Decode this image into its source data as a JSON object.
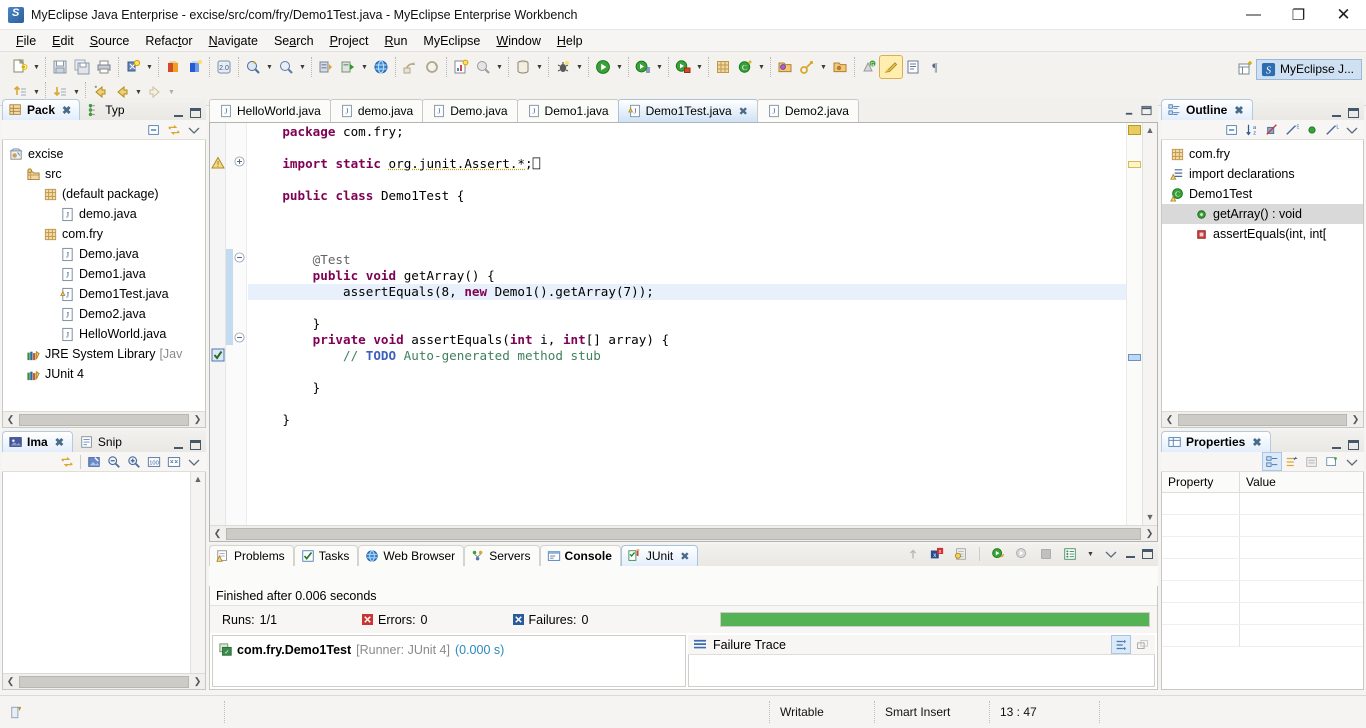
{
  "window": {
    "title": "MyEclipse Java Enterprise - excise/src/com/fry/Demo1Test.java - MyEclipse Enterprise Workbench",
    "app_icon": "myeclipse-icon",
    "minimize": "—",
    "maximize": "❐",
    "close": "✕"
  },
  "menu": [
    {
      "label": "File",
      "mnemonic": "F"
    },
    {
      "label": "Edit",
      "mnemonic": "E"
    },
    {
      "label": "Source",
      "mnemonic": "S"
    },
    {
      "label": "Refactor",
      "mnemonic": "t"
    },
    {
      "label": "Navigate",
      "mnemonic": "N"
    },
    {
      "label": "Search",
      "mnemonic": "a"
    },
    {
      "label": "Project",
      "mnemonic": "P"
    },
    {
      "label": "Run",
      "mnemonic": "R"
    },
    {
      "label": "MyEclipse",
      "mnemonic": ""
    },
    {
      "label": "Window",
      "mnemonic": "W"
    },
    {
      "label": "Help",
      "mnemonic": "H"
    }
  ],
  "toolbar": {
    "row1_groups": [
      [
        "new-wizard-icon",
        "new-dropdown-arrow"
      ],
      [
        "save-icon",
        "save-all-icon",
        "print-icon"
      ],
      [
        "myeclipse-new-icon",
        "myeclipse-dropdown-arrow"
      ],
      [
        "deploy-icon",
        "deploy2-icon"
      ],
      [
        "open-type-icon"
      ],
      [
        "search-icon",
        "search-dropdown-arrow",
        "search2-icon",
        "search2-dropdown-arrow"
      ],
      [
        "server-icon",
        "server-run-icon",
        "server-dropdown-arrow",
        "browser-icon"
      ],
      [
        "history-icon",
        "refresh-icon"
      ],
      [
        "report-icon",
        "report2-icon",
        "report2-dropdown-arrow"
      ],
      [
        "db-icon",
        "db-dropdown-arrow"
      ],
      [
        "debug-icon",
        "debug-dropdown-arrow"
      ],
      [
        "run-icon",
        "run-dropdown-arrow"
      ],
      [
        "run-config-icon",
        "run-config-dropdown-arrow"
      ],
      [
        "coverage-icon",
        "coverage-dropdown-arrow"
      ],
      [
        "new-java-project-icon",
        "new-class-icon",
        "new-class-dropdown-arrow"
      ],
      [
        "open-resource-icon",
        "key-icon",
        "key-dropdown-arrow",
        "open-folder-icon"
      ],
      [
        "annotation-icon",
        "toggle-markoccurrences-icon",
        "toggle-block-icon",
        "show-whitespace-icon"
      ]
    ],
    "row2_groups": [
      [
        "prev-annotation-icon",
        "prev-annotation-arrow"
      ],
      [
        "next-annotation-icon",
        "next-annotation-arrow"
      ],
      [
        "back-icon",
        "forward-icon",
        "forward-arrow",
        "next-edit-icon",
        "next-edit-arrow"
      ]
    ],
    "perspective_open": "open-perspective-icon",
    "perspective_active": "MyEclipse J...",
    "perspective_active_icon": "myeclipse-perspective-icon"
  },
  "package_explorer": {
    "tabs": [
      {
        "label": "Pack",
        "icon": "package-explorer-icon",
        "selected": true,
        "closeable": true
      },
      {
        "label": "Typ",
        "icon": "type-hierarchy-icon",
        "selected": false,
        "closeable": false
      }
    ],
    "toolbar": [
      "collapse-all-icon",
      "link-with-editor-icon",
      "view-menu-icon"
    ],
    "tree": [
      {
        "label": "excise",
        "icon": "java-project-icon",
        "indent": 0
      },
      {
        "label": "src",
        "icon": "source-folder-icon",
        "indent": 1
      },
      {
        "label": "(default package)",
        "icon": "package-icon",
        "indent": 2
      },
      {
        "label": "demo.java",
        "icon": "java-file-icon",
        "indent": 3
      },
      {
        "label": "com.fry",
        "icon": "package-icon",
        "indent": 2
      },
      {
        "label": "Demo.java",
        "icon": "java-file-icon",
        "indent": 3
      },
      {
        "label": "Demo1.java",
        "icon": "java-file-icon",
        "indent": 3
      },
      {
        "label": "Demo1Test.java",
        "icon": "java-file-warning-icon",
        "indent": 3
      },
      {
        "label": "Demo2.java",
        "icon": "java-file-icon",
        "indent": 3
      },
      {
        "label": "HelloWorld.java",
        "icon": "java-file-icon",
        "indent": 3
      },
      {
        "label": "JRE System Library",
        "suffix": "[Jav",
        "icon": "library-icon",
        "indent": 1
      },
      {
        "label": "JUnit 4",
        "icon": "library-icon",
        "indent": 1
      }
    ]
  },
  "image_view": {
    "tabs": [
      {
        "label": "Ima",
        "icon": "image-viewer-icon",
        "selected": true,
        "closeable": true
      },
      {
        "label": "Snip",
        "icon": "snippets-icon",
        "selected": false,
        "closeable": false
      }
    ],
    "toolbar": [
      "link-icon",
      "select-image-icon",
      "zoom-out-icon",
      "zoom-in-icon",
      "zoom-100-icon",
      "fit-icon",
      "view-menu-icon"
    ]
  },
  "editor": {
    "tabs": [
      {
        "label": "HelloWorld.java",
        "icon": "java-file-icon",
        "selected": false,
        "closeable": false
      },
      {
        "label": "demo.java",
        "icon": "java-file-icon",
        "selected": false,
        "closeable": false
      },
      {
        "label": "Demo.java",
        "icon": "java-file-icon",
        "selected": false,
        "closeable": false
      },
      {
        "label": "Demo1.java",
        "icon": "java-file-icon",
        "selected": false,
        "closeable": false
      },
      {
        "label": "Demo1Test.java",
        "icon": "java-file-warning-icon",
        "selected": true,
        "closeable": true
      },
      {
        "label": "Demo2.java",
        "icon": "java-file-icon",
        "selected": false,
        "closeable": false
      }
    ],
    "code_lines": [
      {
        "indent": 1,
        "tokens": [
          {
            "t": "package",
            "c": "kw"
          },
          {
            "t": " com.fry;",
            "c": ""
          }
        ]
      },
      {
        "indent": 0,
        "tokens": []
      },
      {
        "indent": 1,
        "fold": "plus",
        "marker": "warning",
        "tokens": [
          {
            "t": "import",
            "c": "kw"
          },
          {
            "t": " ",
            "c": ""
          },
          {
            "t": "static",
            "c": "kw"
          },
          {
            "t": " ",
            "c": ""
          },
          {
            "t": "org.junit.Assert.*",
            "c": "imp"
          },
          {
            "t": ";",
            "c": ""
          },
          {
            "t": "⎕",
            "c": ""
          }
        ]
      },
      {
        "indent": 0,
        "tokens": []
      },
      {
        "indent": 1,
        "tokens": [
          {
            "t": "public",
            "c": "kw"
          },
          {
            "t": " ",
            "c": ""
          },
          {
            "t": "class",
            "c": "kw"
          },
          {
            "t": " Demo1Test {",
            "c": ""
          }
        ]
      },
      {
        "indent": 0,
        "tokens": []
      },
      {
        "indent": 0,
        "tokens": []
      },
      {
        "indent": 0,
        "tokens": []
      },
      {
        "indent": 2,
        "fold": "minus",
        "tokens": [
          {
            "t": "@Test",
            "c": "ann"
          }
        ]
      },
      {
        "indent": 2,
        "tokens": [
          {
            "t": "public",
            "c": "kw"
          },
          {
            "t": " ",
            "c": ""
          },
          {
            "t": "void",
            "c": "kw"
          },
          {
            "t": " getArray() {",
            "c": ""
          }
        ]
      },
      {
        "indent": 3,
        "highlight": true,
        "tokens": [
          {
            "t": "assertEquals(8, ",
            "c": ""
          },
          {
            "t": "new",
            "c": "kw"
          },
          {
            "t": " Demo1().getArray(7));",
            "c": ""
          }
        ]
      },
      {
        "indent": 0,
        "tokens": []
      },
      {
        "indent": 2,
        "tokens": [
          {
            "t": "}",
            "c": ""
          }
        ]
      },
      {
        "indent": 2,
        "fold": "minus",
        "tokens": [
          {
            "t": "private",
            "c": "kw"
          },
          {
            "t": " ",
            "c": ""
          },
          {
            "t": "void",
            "c": "kw"
          },
          {
            "t": " assertEquals(",
            "c": ""
          },
          {
            "t": "int",
            "c": "kw"
          },
          {
            "t": " i, ",
            "c": ""
          },
          {
            "t": "int",
            "c": "kw"
          },
          {
            "t": "[] array) {",
            "c": ""
          }
        ]
      },
      {
        "indent": 3,
        "marker": "task",
        "tokens": [
          {
            "t": "// ",
            "c": "cmt"
          },
          {
            "t": "TODO",
            "c": "todo"
          },
          {
            "t": " Auto-generated method stub",
            "c": "cmt"
          }
        ]
      },
      {
        "indent": 0,
        "tokens": []
      },
      {
        "indent": 2,
        "tokens": [
          {
            "t": "}",
            "c": ""
          }
        ]
      },
      {
        "indent": 0,
        "tokens": []
      },
      {
        "indent": 1,
        "tokens": [
          {
            "t": "}",
            "c": ""
          }
        ]
      }
    ]
  },
  "outline": {
    "tab": {
      "label": "Outline",
      "icon": "outline-icon"
    },
    "toolbar": [
      "collapse-all-icon",
      "sort-icon",
      "hide-fields-icon",
      "hide-static-icon",
      "hide-nonpublic-icon",
      "hide-local-icon",
      "view-menu-icon"
    ],
    "items": [
      {
        "label": "com.fry",
        "icon": "package-icon",
        "indent": 0,
        "selected": false
      },
      {
        "label": "import declarations",
        "icon": "imports-warning-icon",
        "indent": 0,
        "selected": false
      },
      {
        "label": "Demo1Test",
        "icon": "class-warning-icon",
        "indent": 0,
        "selected": false
      },
      {
        "label": "getArray() : void",
        "icon": "public-method-icon",
        "indent": 1,
        "selected": true
      },
      {
        "label": "assertEquals(int, int[",
        "icon": "private-method-icon",
        "indent": 1,
        "selected": false
      }
    ]
  },
  "properties": {
    "tab": {
      "label": "Properties",
      "icon": "properties-icon"
    },
    "toolbar": [
      "show-categories-icon",
      "show-advanced-icon",
      "restore-defaults-icon",
      "pin-icon",
      "view-menu-icon"
    ],
    "columns": [
      "Property",
      "Value"
    ],
    "rows": []
  },
  "bottom_panel": {
    "tabs": [
      {
        "label": "Problems",
        "icon": "problems-icon",
        "selected": false,
        "closeable": false
      },
      {
        "label": "Tasks",
        "icon": "tasks-icon",
        "selected": false,
        "closeable": false
      },
      {
        "label": "Web Browser",
        "icon": "web-browser-icon",
        "selected": false,
        "closeable": false
      },
      {
        "label": "Servers",
        "icon": "servers-icon",
        "selected": false,
        "closeable": false
      },
      {
        "label": "Console",
        "icon": "console-icon",
        "selected": false,
        "closeable": false,
        "bold": true
      },
      {
        "label": "JUnit",
        "icon": "junit-icon",
        "selected": true,
        "closeable": true
      }
    ],
    "toolbar": [
      "next-failure-icon",
      "prev-failure-icon",
      "show-failures-only-icon",
      "lock-icon",
      "rerun-icon",
      "rerun-failed-icon",
      "stop-icon",
      "history-icon",
      "history-dropdown-arrow",
      "view-menu-icon"
    ]
  },
  "junit": {
    "status_text": "Finished after 0.006 seconds",
    "runs_label": "Runs:",
    "runs_value": "1/1",
    "errors_label": "Errors:",
    "errors_value": "0",
    "failures_label": "Failures:",
    "failures_value": "0",
    "progress_percent": 100,
    "progress_color": "#55b355",
    "result_name": "com.fry.Demo1Test",
    "result_runner": "[Runner: JUnit 4]",
    "result_time": "(0.000 s)",
    "failure_trace_label": "Failure Trace",
    "trace_toolbar": [
      "filter-stack-trace-icon",
      "maximize-icon"
    ]
  },
  "statusbar": {
    "icon": "writable-smart-icon",
    "writable": "Writable",
    "insert_mode": "Smart Insert",
    "position": "13 : 47"
  }
}
